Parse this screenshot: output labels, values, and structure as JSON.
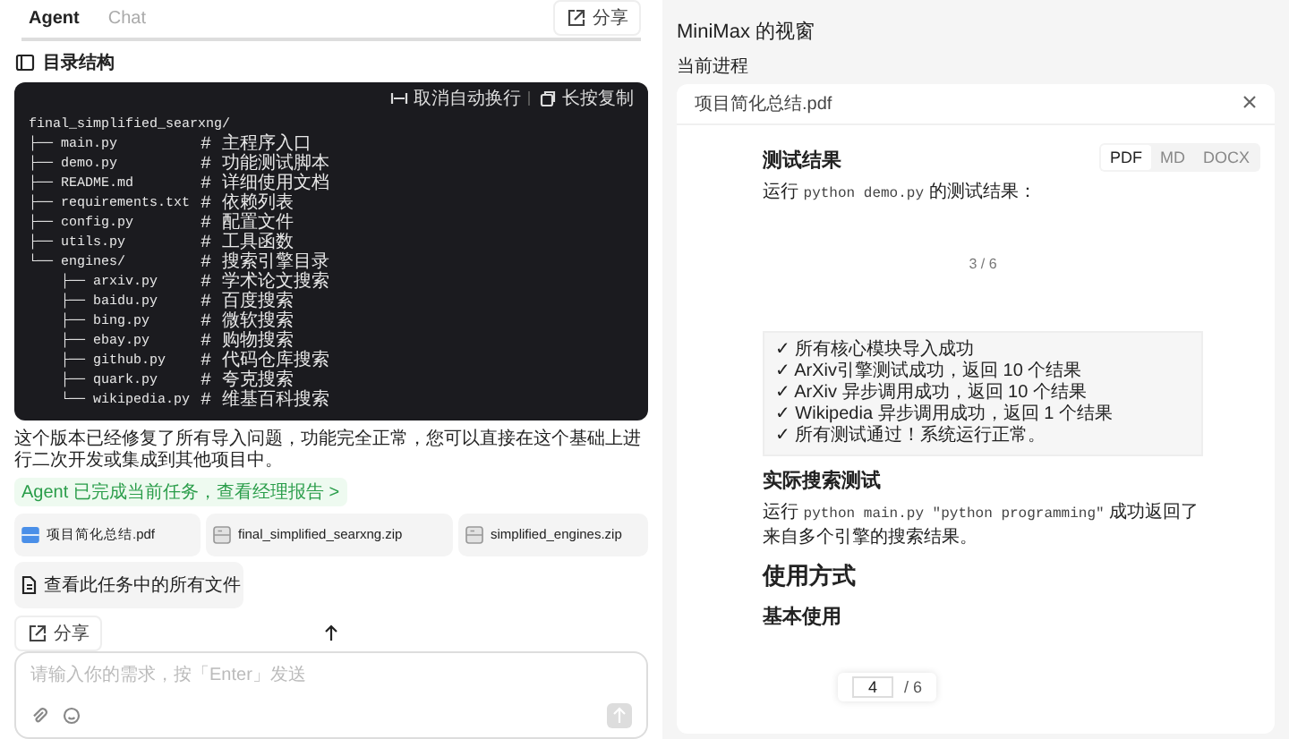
{
  "tabs": [
    {
      "label": "Agent",
      "selected": true
    },
    {
      "label": "Chat",
      "selected": false
    }
  ],
  "share_button": "分享",
  "section": {
    "title": "目录结构"
  },
  "code_block": {
    "actions": [
      {
        "kind": "wrap",
        "label": "取消自动换行"
      },
      {
        "kind": "copy",
        "label": "长按复制"
      }
    ],
    "lines": [
      {
        "text": "final_simplified_searxng/"
      },
      {
        "text": "├── main.py",
        "comment": "# 主程序入口"
      },
      {
        "text": "├── demo.py",
        "comment": "# 功能测试脚本"
      },
      {
        "text": "├── README.md",
        "comment": "# 详细使用文档"
      },
      {
        "text": "├── requirements.txt",
        "comment": "# 依赖列表"
      },
      {
        "text": "├── config.py",
        "comment": "# 配置文件"
      },
      {
        "text": "├── utils.py",
        "comment": "# 工具函数"
      },
      {
        "text": "└── engines/",
        "comment": "# 搜索引擎目录"
      },
      {
        "text": "    ├── arxiv.py",
        "comment": "# 学术论文搜索"
      },
      {
        "text": "    ├── baidu.py",
        "comment": "# 百度搜索"
      },
      {
        "text": "    ├── bing.py",
        "comment": "# 微软搜索"
      },
      {
        "text": "    ├── ebay.py",
        "comment": "# 购物搜索"
      },
      {
        "text": "    ├── github.py",
        "comment": "# 代码仓库搜索"
      },
      {
        "text": "    ├── quark.py",
        "comment": "# 夸克搜索"
      },
      {
        "text": "    └── wikipedia.py",
        "comment": "# 维基百科搜索"
      }
    ]
  },
  "message": "这个版本已经修复了所有导入问题，功能完全正常，您可以直接在这个基础上进行二次开发或集成到其他项目中。",
  "status_link": "Agent 已完成当前任务，查看经理报告 >",
  "files": [
    {
      "name": "项目简化总结.pdf",
      "kind": "pdf"
    },
    {
      "name": "final_simplified_searxng.zip",
      "kind": "zip"
    },
    {
      "name": "simplified_engines.zip",
      "kind": "zip"
    }
  ],
  "all_files_button": "查看此任务中的所有文件",
  "footer_share": "分享",
  "input": {
    "placeholder": "请输入你的需求，按「Enter」发送"
  },
  "viewer": {
    "title": "MiniMax 的视窗",
    "subtitle": "当前进程",
    "file": {
      "name": "项目简化总结.pdf"
    },
    "formats": [
      {
        "label": "PDF",
        "selected": true
      },
      {
        "label": "MD",
        "selected": false
      },
      {
        "label": "DOCX",
        "selected": false
      }
    ],
    "doc": [
      {
        "kind": "h3",
        "text": "测试结果"
      },
      {
        "kind": "p",
        "parts": [
          {
            "text": "运行 ",
            "code": false
          },
          {
            "text": "python demo.py",
            "code": true
          },
          {
            "text": " 的测试结果：",
            "code": false
          }
        ]
      },
      {
        "kind": "page_break",
        "label": "3 / 6"
      },
      {
        "kind": "code",
        "lines": [
          "✓ 所有核心模块导入成功",
          "✓ ArXiv引擎测试成功，返回 10 个结果",
          "✓ ArXiv 异步调用成功，返回 10 个结果",
          "✓ Wikipedia 异步调用成功，返回 1 个结果",
          "✓ 所有测试通过！系统运行正常。"
        ]
      },
      {
        "kind": "h3",
        "text": "实际搜索测试"
      },
      {
        "kind": "p",
        "parts": [
          {
            "text": "运行 ",
            "code": false
          },
          {
            "text": "python main.py \"python programming\"",
            "code": true
          },
          {
            "text": " 成功返回了来自多个引擎的搜索结果。",
            "code": false
          }
        ]
      },
      {
        "kind": "h2",
        "text": "使用方式"
      },
      {
        "kind": "h3",
        "text": "基本使用"
      }
    ],
    "page_indicator": {
      "page": "4",
      "total": "/ 6"
    }
  }
}
